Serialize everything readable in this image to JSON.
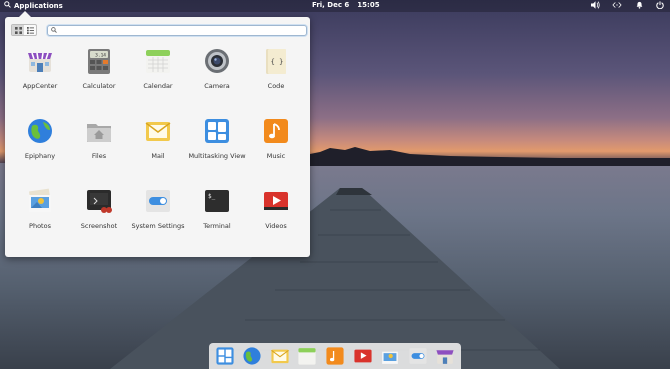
{
  "panel": {
    "applications_label": "Applications",
    "date": "Fri, Dec 6",
    "time": "15:05"
  },
  "launcher": {
    "search": {
      "value": "",
      "placeholder": ""
    },
    "apps": [
      {
        "label": "AppCenter",
        "icon": "appcenter-icon"
      },
      {
        "label": "Calculator",
        "icon": "calculator-icon"
      },
      {
        "label": "Calendar",
        "icon": "calendar-icon"
      },
      {
        "label": "Camera",
        "icon": "camera-icon"
      },
      {
        "label": "Code",
        "icon": "code-icon"
      },
      {
        "label": "Epiphany",
        "icon": "epiphany-icon"
      },
      {
        "label": "Files",
        "icon": "files-icon"
      },
      {
        "label": "Mail",
        "icon": "mail-icon"
      },
      {
        "label": "Multitasking View",
        "icon": "multitasking-icon"
      },
      {
        "label": "Music",
        "icon": "music-icon"
      },
      {
        "label": "Photos",
        "icon": "photos-icon"
      },
      {
        "label": "Screenshot",
        "icon": "screenshot-icon"
      },
      {
        "label": "System Settings",
        "icon": "settings-icon"
      },
      {
        "label": "Terminal",
        "icon": "terminal-icon"
      },
      {
        "label": "Videos",
        "icon": "videos-icon"
      }
    ],
    "calculator_display": "3.14",
    "code_glyph": "{ }",
    "terminal_prompt": "$_"
  },
  "dock": {
    "items": [
      "multitasking-icon",
      "epiphany-icon",
      "mail-icon",
      "calendar-icon",
      "music-icon",
      "videos-icon",
      "photos-icon",
      "settings-icon",
      "appcenter-icon"
    ]
  },
  "colors": {
    "accent": "#3689e6",
    "panel": "#000000"
  }
}
